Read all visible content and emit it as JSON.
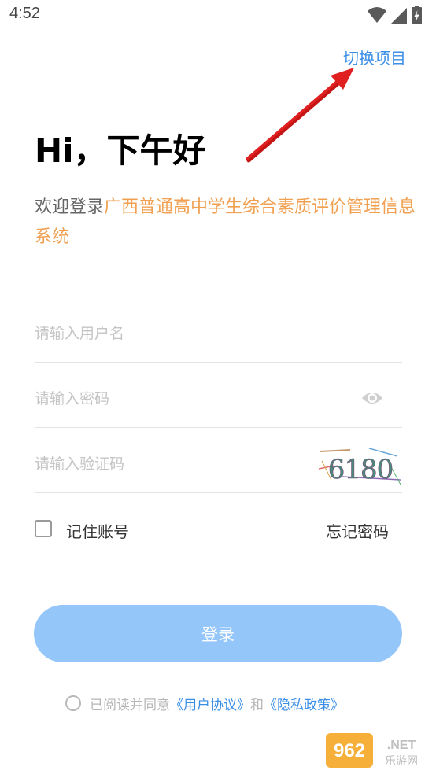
{
  "status_bar": {
    "time": "4:52"
  },
  "header": {
    "switch_project": "切换项目"
  },
  "greeting": "Hi，下午好",
  "welcome": {
    "prefix": "欢迎登录",
    "system_name": "广西普通高中学生综合素质评价管理信息系统"
  },
  "form": {
    "username_placeholder": "请输入用户名",
    "password_placeholder": "请输入密码",
    "captcha_placeholder": "请输入验证码",
    "captcha_code": "6180",
    "remember_label": "记住账号",
    "forgot_label": "忘记密码",
    "login_label": "登录"
  },
  "agreement": {
    "prefix": "已阅读并同意",
    "user_agreement": "《用户协议》",
    "and": "和",
    "privacy_policy": "《隐私政策》"
  },
  "watermark": {
    "number": "962",
    "domain": ".NET",
    "site_name": "乐游网"
  },
  "colors": {
    "accent": "#3a8ee6",
    "system_name": "#f0a050",
    "login_button": "#94c6fa",
    "arrow": "#e02020"
  },
  "icons": [
    "wifi-icon",
    "cell-signal-icon",
    "battery-icon",
    "eye-icon",
    "red-arrow-annotation"
  ]
}
